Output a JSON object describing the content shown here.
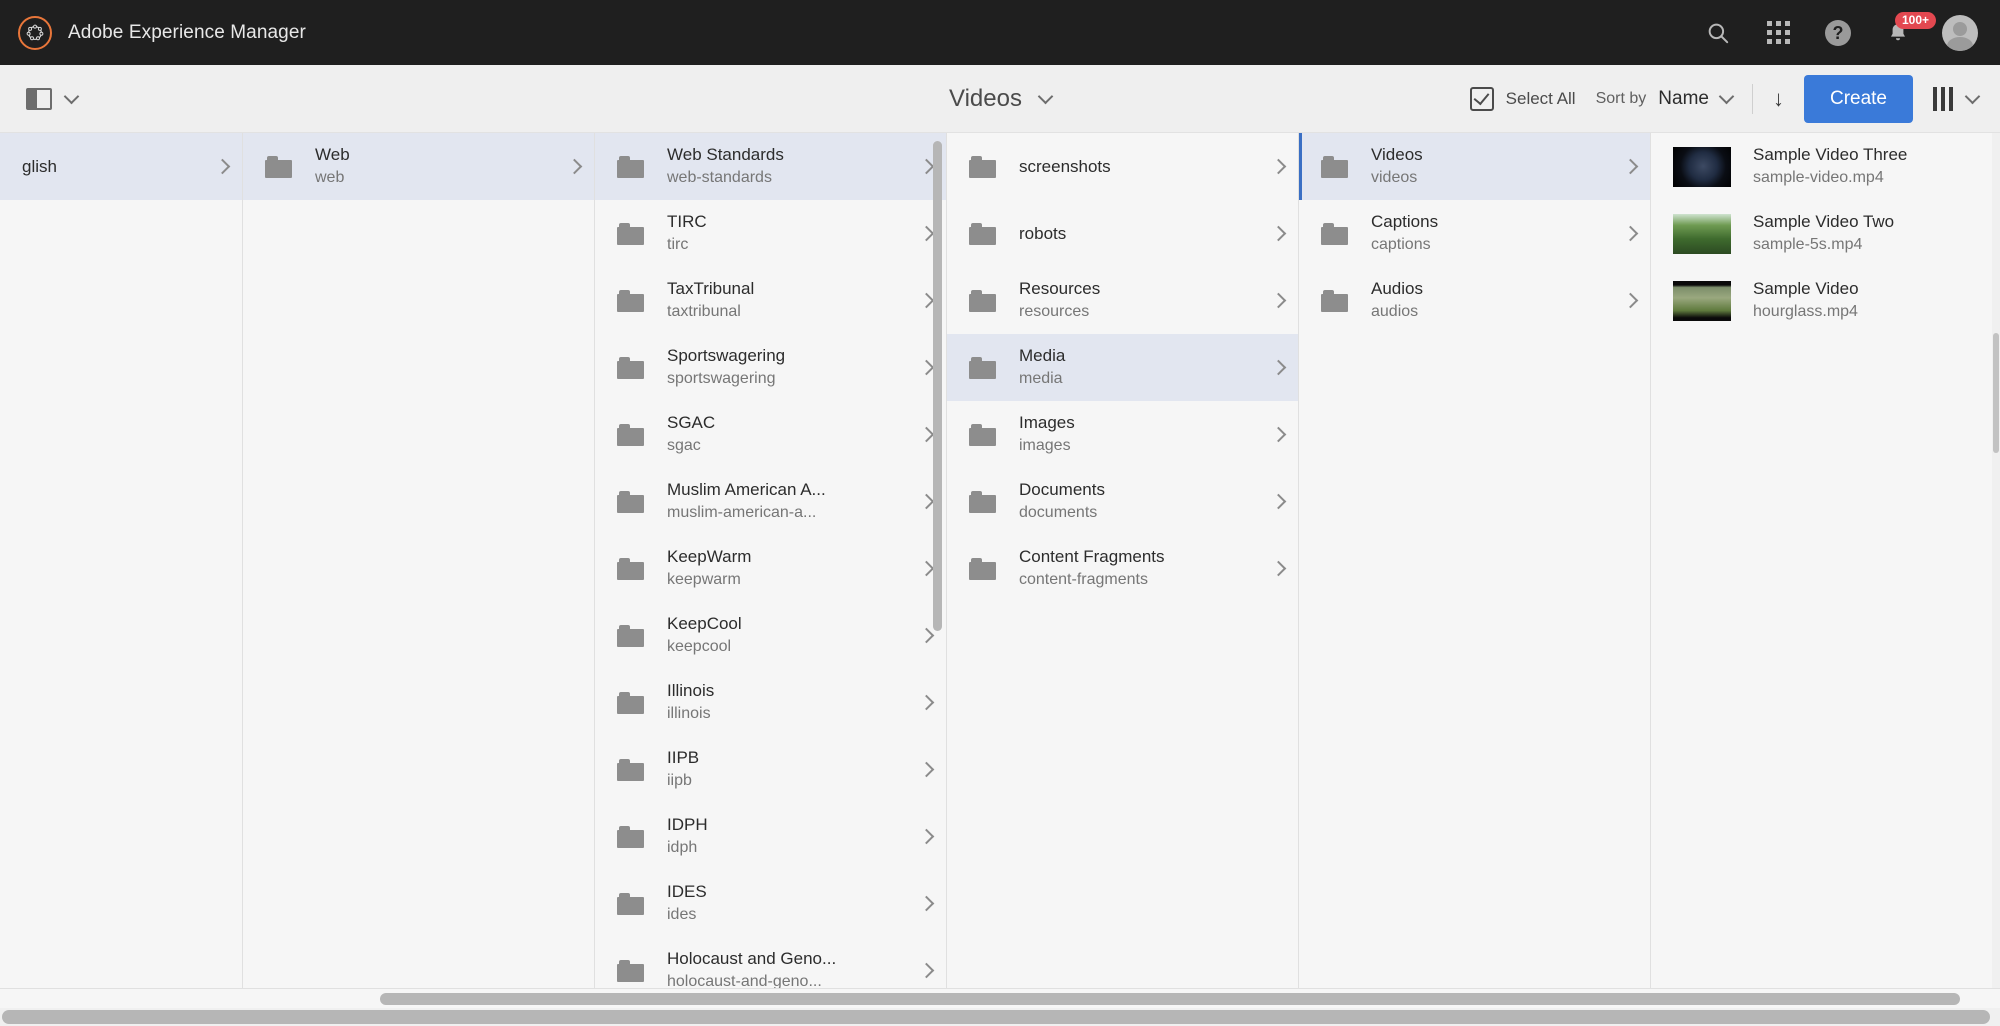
{
  "app": {
    "title": "Adobe Experience Manager",
    "logo_icon": "adobe-experience-manager-logo",
    "accent_blue": "#3a7ad9",
    "brand_orange": "#e8763a",
    "badge_color": "#e34850"
  },
  "topbar": {
    "icons": [
      {
        "name": "search-icon",
        "glyph": "⌕"
      },
      {
        "name": "app-grid-icon",
        "glyph": "grid"
      },
      {
        "name": "help-icon",
        "glyph": "?"
      },
      {
        "name": "notifications-bell-icon",
        "glyph": "🔔"
      }
    ],
    "notification_badge": "100+",
    "avatar_name": "user-avatar"
  },
  "toolbar": {
    "rail_toggle_name": "toggle-side-rail",
    "rail_chevron": "chevron-down-icon",
    "title": "Videos",
    "title_chevron": "chevron-down-icon",
    "select_all_label": "Select All",
    "sort_by_label": "Sort by",
    "sort_value": "Name",
    "sort_chevron": "chevron-down-icon",
    "sort_direction_icon": "arrow-down-icon",
    "create_label": "Create",
    "view_icon": "column-view-icon",
    "view_chevron": "chevron-down-icon"
  },
  "columns": [
    {
      "name": "column-languages",
      "items": [
        {
          "title": "glish",
          "sub": "",
          "selected": true,
          "has_folder_icon": false,
          "chevron": true
        }
      ]
    },
    {
      "name": "column-sites",
      "items": [
        {
          "title": "Web",
          "sub": "web",
          "selected": true,
          "has_folder_icon": true,
          "chevron": true
        }
      ]
    },
    {
      "name": "column-web-children",
      "scrollbar": true,
      "items": [
        {
          "title": "Web Standards",
          "sub": "web-standards",
          "selected": true,
          "has_folder_icon": true,
          "chevron": true
        },
        {
          "title": "TIRC",
          "sub": "tirc",
          "selected": false,
          "has_folder_icon": true,
          "chevron": true
        },
        {
          "title": "TaxTribunal",
          "sub": "taxtribunal",
          "selected": false,
          "has_folder_icon": true,
          "chevron": true
        },
        {
          "title": "Sportswagering",
          "sub": "sportswagering",
          "selected": false,
          "has_folder_icon": true,
          "chevron": true
        },
        {
          "title": "SGAC",
          "sub": "sgac",
          "selected": false,
          "has_folder_icon": true,
          "chevron": true
        },
        {
          "title": "Muslim American A...",
          "sub": "muslim-american-a...",
          "selected": false,
          "has_folder_icon": true,
          "chevron": true
        },
        {
          "title": "KeepWarm",
          "sub": "keepwarm",
          "selected": false,
          "has_folder_icon": true,
          "chevron": true
        },
        {
          "title": "KeepCool",
          "sub": "keepcool",
          "selected": false,
          "has_folder_icon": true,
          "chevron": true
        },
        {
          "title": "Illinois",
          "sub": "illinois",
          "selected": false,
          "has_folder_icon": true,
          "chevron": true
        },
        {
          "title": "IIPB",
          "sub": "iipb",
          "selected": false,
          "has_folder_icon": true,
          "chevron": true
        },
        {
          "title": "IDPH",
          "sub": "idph",
          "selected": false,
          "has_folder_icon": true,
          "chevron": true
        },
        {
          "title": "IDES",
          "sub": "ides",
          "selected": false,
          "has_folder_icon": true,
          "chevron": true
        },
        {
          "title": "Holocaust and Geno...",
          "sub": "holocaust-and-geno...",
          "selected": false,
          "has_folder_icon": true,
          "chevron": true
        }
      ]
    },
    {
      "name": "column-web-standards-children",
      "items": [
        {
          "title": "screenshots",
          "sub": "",
          "selected": false,
          "has_folder_icon": true,
          "chevron": true
        },
        {
          "title": "robots",
          "sub": "",
          "selected": false,
          "has_folder_icon": true,
          "chevron": true
        },
        {
          "title": "Resources",
          "sub": "resources",
          "selected": false,
          "has_folder_icon": true,
          "chevron": true
        },
        {
          "title": "Media",
          "sub": "media",
          "selected": true,
          "has_folder_icon": true,
          "chevron": true
        },
        {
          "title": "Images",
          "sub": "images",
          "selected": false,
          "has_folder_icon": true,
          "chevron": true
        },
        {
          "title": "Documents",
          "sub": "documents",
          "selected": false,
          "has_folder_icon": true,
          "chevron": true
        },
        {
          "title": "Content Fragments",
          "sub": "content-fragments",
          "selected": false,
          "has_folder_icon": true,
          "chevron": true
        }
      ]
    },
    {
      "name": "column-media-children",
      "items": [
        {
          "title": "Videos",
          "sub": "videos",
          "selected": true,
          "active": true,
          "has_folder_icon": true,
          "chevron": true
        },
        {
          "title": "Captions",
          "sub": "captions",
          "selected": false,
          "has_folder_icon": true,
          "chevron": true
        },
        {
          "title": "Audios",
          "sub": "audios",
          "selected": false,
          "has_folder_icon": true,
          "chevron": true
        }
      ]
    },
    {
      "name": "column-video-assets",
      "items": [
        {
          "title": "Sample Video Three",
          "sub": "sample-video.mp4",
          "selected": false,
          "thumb": "dark-planet",
          "chevron": false
        },
        {
          "title": "Sample Video Two",
          "sub": "sample-5s.mp4",
          "selected": false,
          "thumb": "green-trees",
          "chevron": false
        },
        {
          "title": "Sample Video",
          "sub": "hourglass.mp4",
          "selected": false,
          "thumb": "grass-rocks",
          "chevron": false
        }
      ]
    }
  ]
}
